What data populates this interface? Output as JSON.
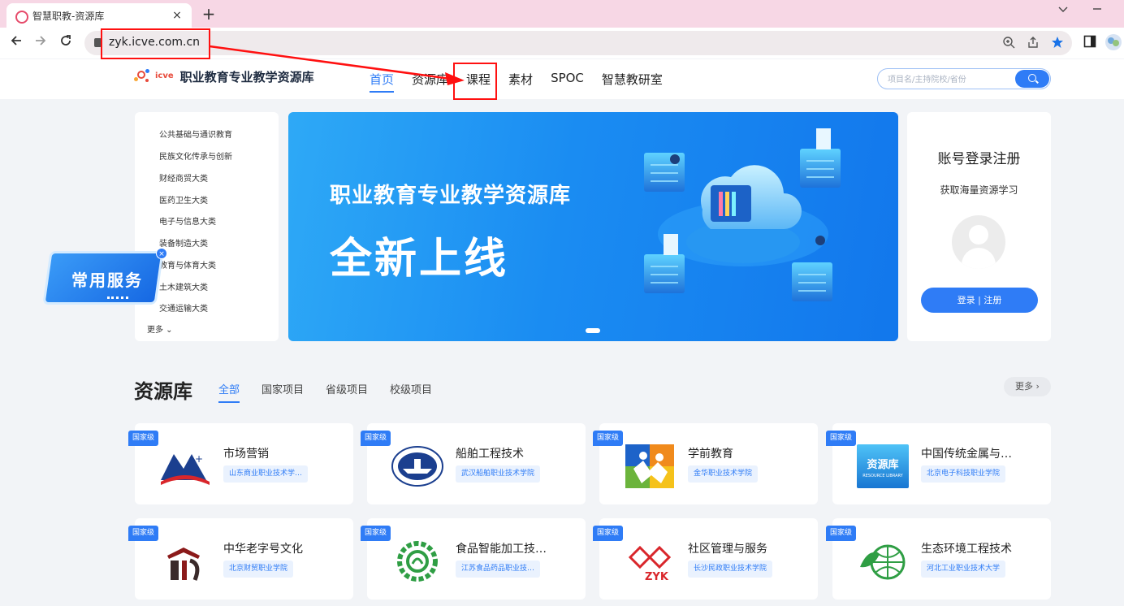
{
  "browser": {
    "tab_title": "智慧职教-资源库",
    "tab_close": "×",
    "new_tab": "+",
    "url": "zyk.icve.com.cn",
    "colors": {
      "tabbar": "#f7d7e5",
      "highlight": "#ff1010"
    }
  },
  "site": {
    "brand": "icve",
    "name": "职业教育专业教学资源库",
    "nav": [
      {
        "label": "首页",
        "active": true
      },
      {
        "label": "资源库"
      },
      {
        "label": "课程"
      },
      {
        "label": "素材"
      },
      {
        "label": "SPOC"
      },
      {
        "label": "智慧教研室"
      }
    ],
    "search_placeholder": "项目名/主持院校/省份",
    "accent": "#2f7cf6"
  },
  "categories": {
    "items": [
      "公共基础与通识教育",
      "民族文化传承与创新",
      "财经商贸大类",
      "医药卫生大类",
      "电子与信息大类",
      "装备制造大类",
      "教育与体育大类",
      "土木建筑大类",
      "交通运输大类"
    ],
    "more": "更多 ⌄"
  },
  "banner": {
    "subtitle": "职业教育专业教学资源库",
    "headline": "全新上线"
  },
  "login": {
    "title": "账号登录注册",
    "subtitle": "获取海量资源学习",
    "button": "登录 | 注册"
  },
  "float_service": {
    "label": "常用服务",
    "close": "×"
  },
  "resources": {
    "title": "资源库",
    "tabs": [
      {
        "label": "全部",
        "active": true
      },
      {
        "label": "国家项目"
      },
      {
        "label": "省级项目"
      },
      {
        "label": "校级项目"
      }
    ],
    "more": "更多 ›",
    "cards": [
      {
        "badge": "国家级",
        "name": "市场营销",
        "school": "山东商业职业技术学…",
        "logo": "market-logo-icon"
      },
      {
        "badge": "国家级",
        "name": "船舶工程技术",
        "school": "武汉船舶职业技术学院",
        "logo": "ship-logo-icon"
      },
      {
        "badge": "国家级",
        "name": "学前教育",
        "school": "金华职业技术学院",
        "logo": "preschool-logo-icon"
      },
      {
        "badge": "国家级",
        "name": "中国传统金属与…",
        "school": "北京电子科技职业学院",
        "logo": "resource-library-logo-icon",
        "logo_text": "资源库",
        "logo_sub": "RESOURCE LIBRARY"
      },
      {
        "badge": "国家级",
        "name": "中华老字号文化",
        "school": "北京财贸职业学院",
        "logo": "laozihao-logo-icon"
      },
      {
        "badge": "国家级",
        "name": "食品智能加工技…",
        "school": "江苏食品药品职业技…",
        "logo": "food-logo-icon"
      },
      {
        "badge": "国家级",
        "name": "社区管理与服务",
        "school": "长沙民政职业技术学院",
        "logo": "community-logo-icon",
        "logo_text": "ZYK"
      },
      {
        "badge": "国家级",
        "name": "生态环境工程技术",
        "school": "河北工业职业技术大学",
        "logo": "ecology-logo-icon"
      }
    ]
  }
}
